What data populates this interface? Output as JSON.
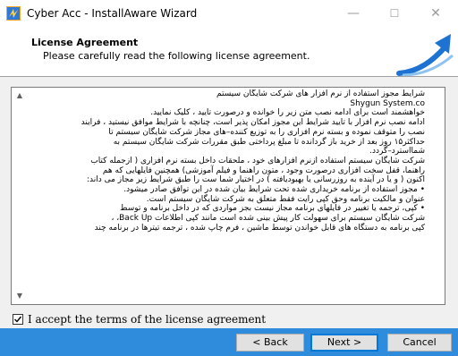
{
  "window": {
    "title": "Cyber Acc - InstallAware Wizard",
    "minimize": "—",
    "maximize": "☐",
    "close": "✕"
  },
  "header": {
    "title": "License Agreement",
    "subtitle": "Please carefully read the following license agreement."
  },
  "license": {
    "lines": [
      "شرایط مجوز استفاده از نرم افزار های شرکت شایگان سیستم",
      "Shygun System.co",
      "خواهشمند است برای ادامه نصب متن زیر را خوانده و درصورت  تایید ، کلیک نمایید.",
      "ادامه نصب نرم افزار با تایید شرایط این مجوز امکان پذیر است، چنانچه با شرایط موافق نیستید ، فرایند",
      "نصب را متوقف نموده و بسته نرم افزاری را به توزیع کننده–های مجاز شرکت شایگان سیستم تا",
      "حداکثر۱۵ روز بعد از خرید باز گردانده تا مبلغ پرداختی طبق مقررات شرکت شایگان سیستم به",
      "شمااسترد–گردد.",
      "شرکت شایگان سیستم استفاده ازنرم افزارهای خود ، ملحقات داخل بسته نرم افزاری ( ازجمله کتاب",
      "راهنما، قفل سخت افزاری درصورت وجود ، متون راهنما و فیلم آموزشی) همچنین فایلهایی که هم",
      "اکنون ( و یا در آینده به روزرسانی یا بهبودیافته ) در اختیار شما ست را طبق شرایط زیر مجاز می داند:",
      "•  مجوز استفاده از برنامه خریداری شده تحت شرایط بیان شده در این توافق صادر میشود.",
      "عنوان و مالکیت  برنامه وحق کپی رایت فقط متعلق به شرکت شایگان سیستم است.",
      "•  کپی، ترجمه یا تغییر در فایلهای برنامه مجاز نیست بجز مواردی که در داخل برنامه و توسط",
      "شرکت شایگان سیستم برای سهولت کار پیش بینی شده است مانند  کپی اطلاعات  Back Up،  ،",
      "کپی برنامه به  دستگاه های قابل خواندن توسط ماشین ، فرم چاپ شده ، ترجمه تیترها در برنامه چند"
    ]
  },
  "accept": {
    "label": "I accept the terms of the license agreement",
    "checked": true
  },
  "buttons": {
    "back": "< Back",
    "next": "Next >",
    "cancel": "Cancel"
  },
  "colors": {
    "footer": "#2f8bdc",
    "logo_blue": "#1e73d2"
  }
}
